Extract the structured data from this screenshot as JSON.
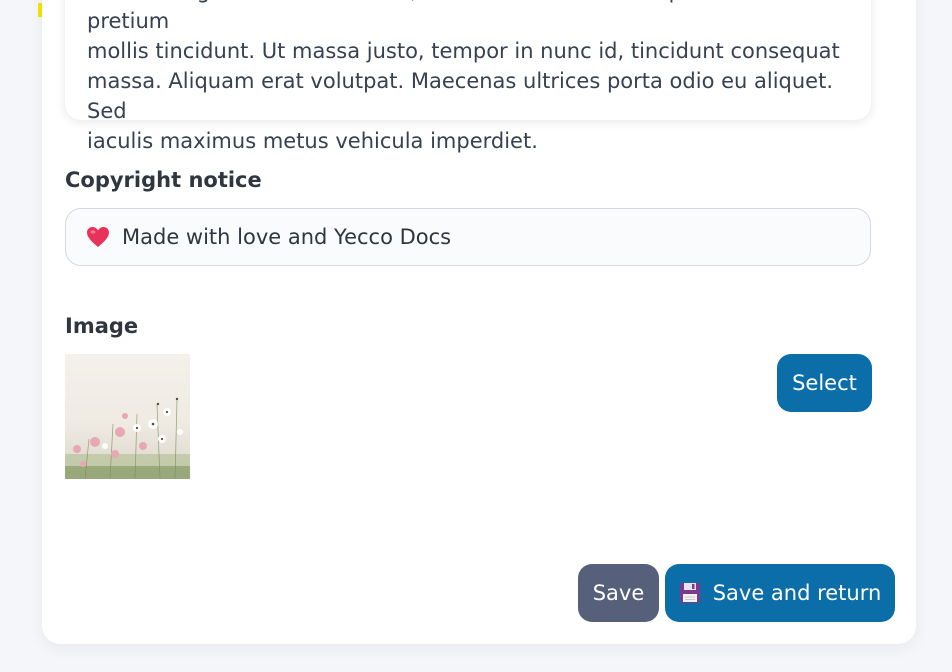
{
  "description": {
    "text": "Aenean sagittis venenatis eros, vel mollis velit rutrum quis. Nullam pretium\nmollis tincidunt. Ut massa justo, tempor in nunc id, tincidunt consequat\nmassa. Aliquam erat volutpat. Maecenas ultrices porta odio eu aliquet. Sed\niaculis maximus metus vehicula imperdiet."
  },
  "copyright": {
    "label": "Copyright notice",
    "value": "Made with love and Yecco Docs",
    "icon": "heart-icon"
  },
  "image": {
    "label": "Image",
    "select_label": "Select",
    "thumbnail": "flower-field-thumbnail"
  },
  "actions": {
    "save_label": "Save",
    "save_return_label": "Save and return",
    "save_return_icon": "floppy-disk-icon"
  },
  "colors": {
    "primary": "#0b6ea8",
    "secondary": "#56607a",
    "heart": "#e8325a",
    "marker": "#f5e400"
  }
}
